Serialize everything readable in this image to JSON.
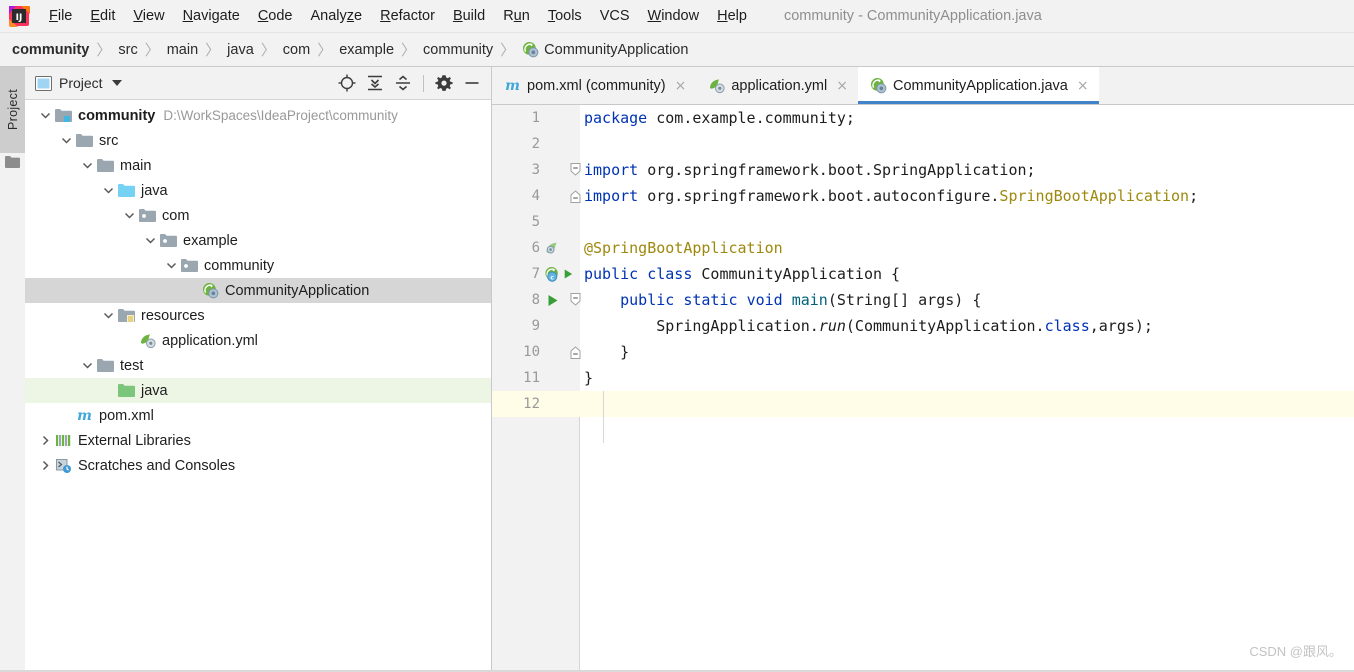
{
  "window": {
    "title": "community - CommunityApplication.java",
    "app_icon": "intellij-idea-logo"
  },
  "menubar": {
    "items": [
      {
        "label": "File",
        "mnemonic": "F"
      },
      {
        "label": "Edit",
        "mnemonic": "E"
      },
      {
        "label": "View",
        "mnemonic": "V"
      },
      {
        "label": "Navigate",
        "mnemonic": "N"
      },
      {
        "label": "Code",
        "mnemonic": "C"
      },
      {
        "label": "Analyze",
        "mnemonic": "z"
      },
      {
        "label": "Refactor",
        "mnemonic": "R"
      },
      {
        "label": "Build",
        "mnemonic": "B"
      },
      {
        "label": "Run",
        "mnemonic": "u"
      },
      {
        "label": "Tools",
        "mnemonic": "T"
      },
      {
        "label": "VCS",
        "mnemonic": ""
      },
      {
        "label": "Window",
        "mnemonic": "W"
      },
      {
        "label": "Help",
        "mnemonic": "H"
      }
    ]
  },
  "breadcrumb": {
    "separator": "〉",
    "items": [
      {
        "label": "community",
        "bold": true,
        "icon": null
      },
      {
        "label": "src",
        "bold": false,
        "icon": null
      },
      {
        "label": "main",
        "bold": false,
        "icon": null
      },
      {
        "label": "java",
        "bold": false,
        "icon": null
      },
      {
        "label": "com",
        "bold": false,
        "icon": null
      },
      {
        "label": "example",
        "bold": false,
        "icon": null
      },
      {
        "label": "community",
        "bold": false,
        "icon": null
      },
      {
        "label": "CommunityApplication",
        "bold": false,
        "icon": "spring-boot-class-icon"
      }
    ]
  },
  "left_strip": {
    "tab_label": "Project",
    "folder_icon": "folder-icon"
  },
  "project_panel": {
    "title": "Project",
    "view_icon": "project-view-icon",
    "dropdown_icon": "chevron-down-icon",
    "tools": [
      {
        "name": "locate-icon",
        "title": "Select Opened File"
      },
      {
        "name": "expand-all-icon",
        "title": "Expand All"
      },
      {
        "name": "collapse-all-icon",
        "title": "Collapse All"
      },
      {
        "name": "settings-gear-icon",
        "title": "Settings"
      },
      {
        "name": "hide-icon",
        "title": "Hide"
      }
    ],
    "tree": [
      {
        "label": "community",
        "path": "D:\\WorkSpaces\\IdeaProject\\community",
        "indent": 0,
        "twist": "down",
        "icon": "module-folder-icon",
        "bold": true,
        "state": "normal"
      },
      {
        "label": "src",
        "path": "",
        "indent": 1,
        "twist": "down",
        "icon": "folder-gray-icon",
        "bold": false,
        "state": "normal"
      },
      {
        "label": "main",
        "path": "",
        "indent": 2,
        "twist": "down",
        "icon": "folder-gray-icon",
        "bold": false,
        "state": "normal"
      },
      {
        "label": "java",
        "path": "",
        "indent": 3,
        "twist": "down",
        "icon": "folder-source-blue-icon",
        "bold": false,
        "state": "normal"
      },
      {
        "label": "com",
        "path": "",
        "indent": 4,
        "twist": "down",
        "icon": "package-icon",
        "bold": false,
        "state": "normal"
      },
      {
        "label": "example",
        "path": "",
        "indent": 5,
        "twist": "down",
        "icon": "package-icon",
        "bold": false,
        "state": "normal"
      },
      {
        "label": "community",
        "path": "",
        "indent": 6,
        "twist": "down",
        "icon": "package-icon",
        "bold": false,
        "state": "normal"
      },
      {
        "label": "CommunityApplication",
        "path": "",
        "indent": 7,
        "twist": "none",
        "icon": "spring-boot-class-icon",
        "bold": false,
        "state": "selected"
      },
      {
        "label": "resources",
        "path": "",
        "indent": 3,
        "twist": "down",
        "icon": "folder-resources-icon",
        "bold": false,
        "state": "normal"
      },
      {
        "label": "application.yml",
        "path": "",
        "indent": 4,
        "twist": "none",
        "icon": "spring-yaml-icon",
        "bold": false,
        "state": "normal"
      },
      {
        "label": "test",
        "path": "",
        "indent": 2,
        "twist": "down",
        "icon": "folder-gray-icon",
        "bold": false,
        "state": "normal"
      },
      {
        "label": "java",
        "path": "",
        "indent": 3,
        "twist": "none",
        "icon": "folder-test-green-icon",
        "bold": false,
        "state": "green"
      },
      {
        "label": "pom.xml",
        "path": "",
        "indent": 1,
        "twist": "none",
        "icon": "maven-m-icon",
        "bold": false,
        "state": "normal"
      },
      {
        "label": "External Libraries",
        "path": "",
        "indent": 0,
        "twist": "right",
        "icon": "libraries-icon",
        "bold": false,
        "state": "normal"
      },
      {
        "label": "Scratches and Consoles",
        "path": "",
        "indent": 0,
        "twist": "right",
        "icon": "scratches-icon",
        "bold": false,
        "state": "normal"
      }
    ]
  },
  "editor": {
    "tabs": [
      {
        "label": "pom.xml (community)",
        "icon": "maven-m-icon",
        "active": false,
        "close": "×"
      },
      {
        "label": "application.yml",
        "icon": "spring-yaml-icon",
        "active": false,
        "close": "×"
      },
      {
        "label": "CommunityApplication.java",
        "icon": "spring-boot-class-icon",
        "active": true,
        "close": "×"
      }
    ],
    "active_tab_accent": "#4083c9",
    "caret_line": 12,
    "caret_line_color": "#fffce8",
    "lines": [
      {
        "num": "1",
        "gutter_icon": null,
        "fold": null,
        "tokens": [
          {
            "t": "package",
            "c": "kw"
          },
          {
            "t": " com.example.community;",
            "c": ""
          }
        ]
      },
      {
        "num": "2",
        "gutter_icon": null,
        "fold": null,
        "tokens": []
      },
      {
        "num": "3",
        "gutter_icon": null,
        "fold": "open",
        "tokens": [
          {
            "t": "import",
            "c": "kw"
          },
          {
            "t": " org.springframework.boot.SpringApplication;",
            "c": ""
          }
        ]
      },
      {
        "num": "4",
        "gutter_icon": null,
        "fold": "end",
        "tokens": [
          {
            "t": "import",
            "c": "kw"
          },
          {
            "t": " org.springframework.boot.autoconfigure.",
            "c": ""
          },
          {
            "t": "SpringBootApplication",
            "c": "cls"
          },
          {
            "t": ";",
            "c": ""
          }
        ]
      },
      {
        "num": "5",
        "gutter_icon": null,
        "fold": null,
        "tokens": []
      },
      {
        "num": "6",
        "gutter_icon": "spring-bean-leaf-icon",
        "fold": null,
        "tokens": [
          {
            "t": "@SpringBootApplication",
            "c": "anno"
          }
        ]
      },
      {
        "num": "7",
        "gutter_icon": "spring-boot-run-icon",
        "fold": null,
        "tokens": [
          {
            "t": "public",
            "c": "kw"
          },
          {
            "t": " ",
            "c": ""
          },
          {
            "t": "class",
            "c": "kw"
          },
          {
            "t": " CommunityApplication {",
            "c": ""
          }
        ]
      },
      {
        "num": "8",
        "gutter_icon": "run-arrow-icon",
        "fold": "open",
        "tokens": [
          {
            "t": "    ",
            "c": ""
          },
          {
            "t": "public",
            "c": "kw"
          },
          {
            "t": " ",
            "c": ""
          },
          {
            "t": "static",
            "c": "kw"
          },
          {
            "t": " ",
            "c": ""
          },
          {
            "t": "void",
            "c": "kw"
          },
          {
            "t": " ",
            "c": ""
          },
          {
            "t": "main",
            "c": "mth"
          },
          {
            "t": "(String[] args) {",
            "c": ""
          }
        ]
      },
      {
        "num": "9",
        "gutter_icon": null,
        "fold": null,
        "tokens": [
          {
            "t": "        SpringApplication.",
            "c": ""
          },
          {
            "t": "run",
            "c": "ital"
          },
          {
            "t": "(CommunityApplication.",
            "c": ""
          },
          {
            "t": "class",
            "c": "kw-cls"
          },
          {
            "t": ",args);",
            "c": ""
          }
        ]
      },
      {
        "num": "10",
        "gutter_icon": null,
        "fold": "end",
        "tokens": [
          {
            "t": "    }",
            "c": ""
          }
        ]
      },
      {
        "num": "11",
        "gutter_icon": null,
        "fold": null,
        "tokens": [
          {
            "t": "}",
            "c": ""
          }
        ]
      },
      {
        "num": "12",
        "gutter_icon": null,
        "fold": null,
        "tokens": []
      }
    ]
  },
  "watermark": {
    "text": "CSDN @跟风。"
  }
}
